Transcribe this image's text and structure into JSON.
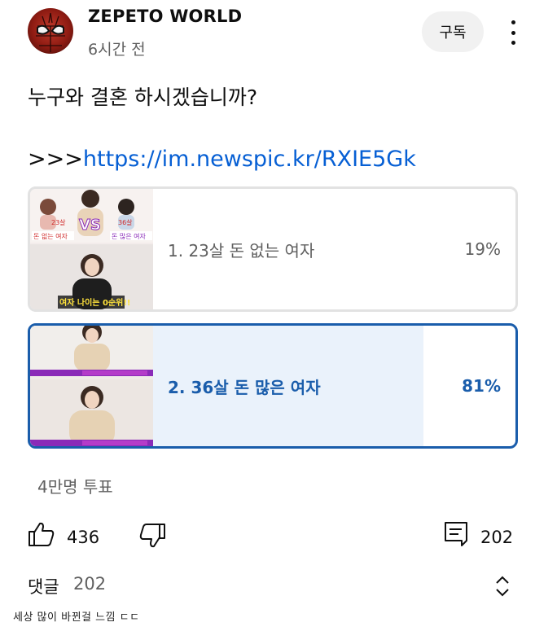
{
  "header": {
    "channel_name": "ZEPETO WORLD",
    "post_time": "6시간 전",
    "subscribe_label": "구독"
  },
  "post": {
    "question": "누구와 결혼 하시겠습니까?",
    "link_prefix": ">>>",
    "link_url": "https://im.newspic.kr/RXIE5Gk"
  },
  "poll": {
    "options": [
      {
        "label": "1. 23살 돈 없는 여자",
        "percent": "19%",
        "fraction": 0.19,
        "selected": false,
        "thumb_texts": [
          "23살",
          "VS",
          "36살",
          "돈 없는 여자",
          "돈 많은 여자",
          "여자 나이는 0순위!!"
        ]
      },
      {
        "label": "2. 36살 돈 많은 여자",
        "percent": "81%",
        "fraction": 0.81,
        "selected": true,
        "thumb_texts": []
      }
    ],
    "votes": "4만명 투표"
  },
  "actions": {
    "like_count": "436",
    "comment_count": "202"
  },
  "comments": {
    "title": "댓글",
    "count": "202"
  },
  "caption": "세상 많이 바뀐걸 느낌 ㄷㄷ",
  "colors": {
    "selected_blue": "#1a5dab",
    "link_blue": "#065fd4",
    "muted_gray": "#606060",
    "pill_bg": "#f1f1f1"
  }
}
